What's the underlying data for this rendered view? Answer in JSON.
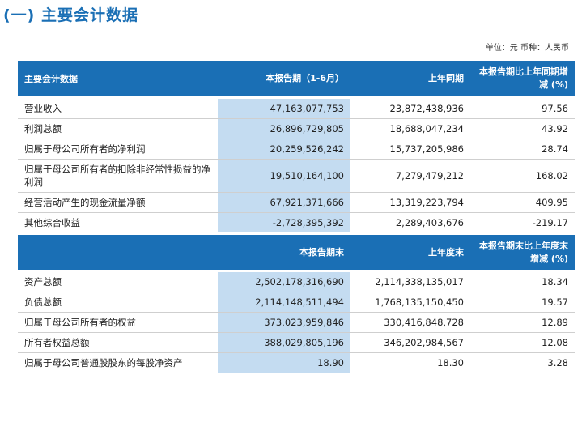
{
  "title": "(一) 主要会计数据",
  "unit_note": "单位：元  币种：人民币",
  "section1": {
    "headers": [
      "主要会计数据",
      "本报告期（1-6月）",
      "上年同期",
      "本报告期比上年同期增减 (%)"
    ],
    "rows": [
      {
        "label": "营业收入",
        "current": "47,163,077,753",
        "prior": "23,872,438,936",
        "change": "97.56"
      },
      {
        "label": "利润总额",
        "current": "26,896,729,805",
        "prior": "18,688,047,234",
        "change": "43.92"
      },
      {
        "label": "归属于母公司所有者的净利润",
        "current": "20,259,526,242",
        "prior": "15,737,205,986",
        "change": "28.74"
      },
      {
        "label": "归属于母公司所有者的扣除非经常性损益的净利润",
        "current": "19,510,164,100",
        "prior": "7,279,479,212",
        "change": "168.02"
      },
      {
        "label": "经营活动产生的现金流量净额",
        "current": "67,921,371,666",
        "prior": "13,319,223,794",
        "change": "409.95"
      },
      {
        "label": "其他综合收益",
        "current": "-2,728,395,392",
        "prior": "2,289,403,676",
        "change": "-219.17"
      }
    ]
  },
  "section2": {
    "headers": [
      "",
      "本报告期末",
      "上年度末",
      "本报告期末比上年度末增减 (%)"
    ],
    "rows": [
      {
        "label": "资产总额",
        "current": "2,502,178,316,690",
        "prior": "2,114,338,135,017",
        "change": "18.34"
      },
      {
        "label": "负债总额",
        "current": "2,114,148,511,494",
        "prior": "1,768,135,150,450",
        "change": "19.57"
      },
      {
        "label": "归属于母公司所有者的权益",
        "current": "373,023,959,846",
        "prior": "330,416,848,728",
        "change": "12.89"
      },
      {
        "label": "所有者权益总额",
        "current": "388,029,805,196",
        "prior": "346,202,984,567",
        "change": "12.08"
      },
      {
        "label": "归属于母公司普通股股东的每股净资产",
        "current": "18.90",
        "prior": "18.30",
        "change": "3.28"
      }
    ]
  }
}
